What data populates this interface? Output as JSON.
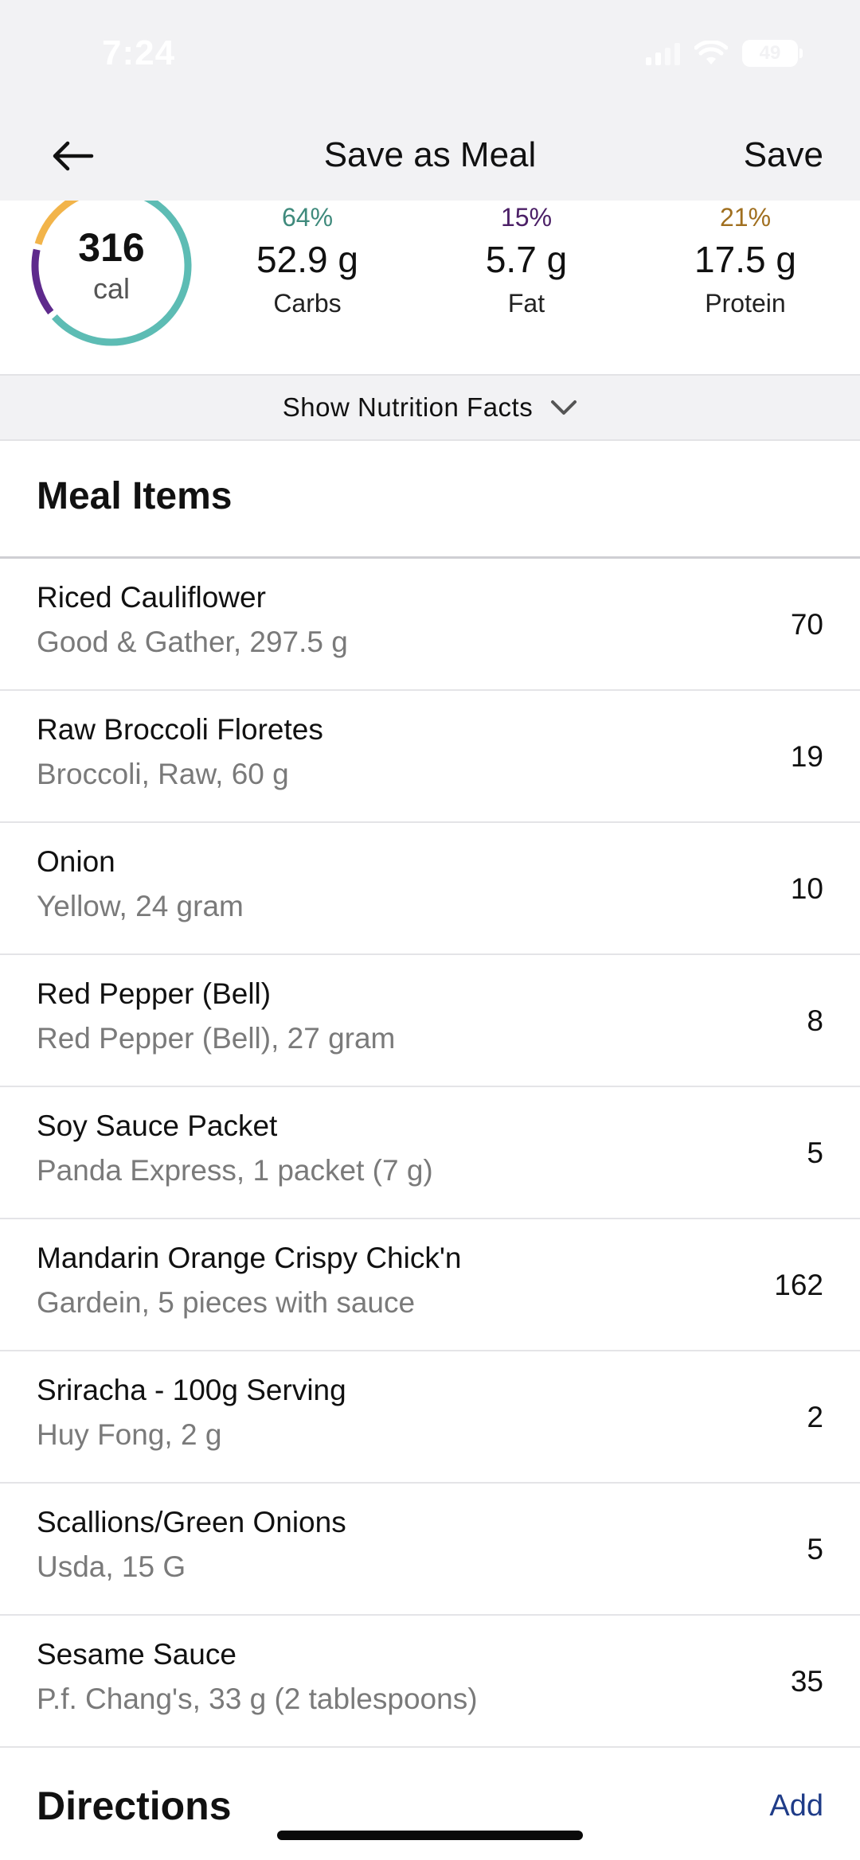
{
  "status_bar": {
    "time": "7:24",
    "battery": "49"
  },
  "nav": {
    "title": "Save as Meal",
    "save_label": "Save",
    "back_icon": "arrow-left-icon"
  },
  "summary": {
    "calories": "316",
    "calories_unit": "cal",
    "ring_segments": [
      {
        "name": "Carbs",
        "fraction": 0.64,
        "color": "#5dbcb4"
      },
      {
        "name": "Fat",
        "fraction": 0.15,
        "color": "#5e2a8c"
      },
      {
        "name": "Protein",
        "fraction": 0.21,
        "color": "#f2b44a"
      }
    ],
    "macros": [
      {
        "percent": "64%",
        "amount": "52.9 g",
        "name": "Carbs",
        "color": "#3f8a7c"
      },
      {
        "percent": "15%",
        "amount": "5.7 g",
        "name": "Fat",
        "color": "#4b1f66"
      },
      {
        "percent": "21%",
        "amount": "17.5 g",
        "name": "Protein",
        "color": "#a06f1f"
      }
    ]
  },
  "facts_toggle": {
    "label": "Show Nutrition Facts",
    "icon": "chevron-down-icon"
  },
  "meal_items": {
    "title": "Meal Items",
    "items": [
      {
        "name": "Riced Cauliflower",
        "desc": "Good & Gather, 297.5 g",
        "cal": "70"
      },
      {
        "name": "Raw Broccoli Floretes",
        "desc": "Broccoli, Raw, 60 g",
        "cal": "19"
      },
      {
        "name": "Onion",
        "desc": "Yellow, 24 gram",
        "cal": "10"
      },
      {
        "name": "Red Pepper (Bell)",
        "desc": "Red Pepper (Bell), 27 gram",
        "cal": "8"
      },
      {
        "name": "Soy Sauce Packet",
        "desc": "Panda Express, 1 packet (7 g)",
        "cal": "5"
      },
      {
        "name": "Mandarin Orange Crispy Chick'n",
        "desc": "Gardein, 5 pieces with sauce",
        "cal": "162"
      },
      {
        "name": "Sriracha - 100g Serving",
        "desc": "Huy Fong, 2 g",
        "cal": "2"
      },
      {
        "name": "Scallions/Green Onions",
        "desc": "Usda, 15 G",
        "cal": "5"
      },
      {
        "name": "Sesame Sauce",
        "desc": "P.f. Chang's, 33 g (2 tablespoons)",
        "cal": "35"
      }
    ]
  },
  "directions": {
    "title": "Directions",
    "add_label": "Add"
  }
}
